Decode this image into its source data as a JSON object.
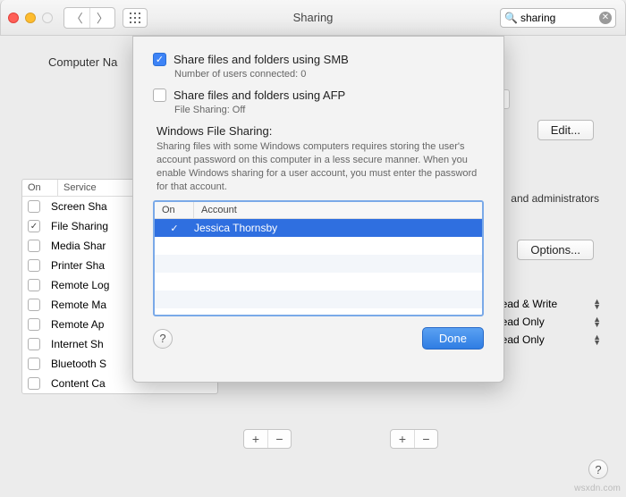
{
  "titlebar": {
    "title": "Sharing",
    "search_value": "sharing"
  },
  "main": {
    "computer_name_label": "Computer Na",
    "edit_label": "Edit...",
    "options_label": "Options...",
    "admins_text": "and administrators"
  },
  "services": {
    "head_on": "On",
    "head_service": "Service",
    "rows": [
      {
        "label": "Screen Sha",
        "checked": false
      },
      {
        "label": "File Sharing",
        "checked": true
      },
      {
        "label": "Media Shar",
        "checked": false
      },
      {
        "label": "Printer Sha",
        "checked": false
      },
      {
        "label": "Remote Log",
        "checked": false
      },
      {
        "label": "Remote Ma",
        "checked": false
      },
      {
        "label": "Remote Ap",
        "checked": false
      },
      {
        "label": "Internet Sh",
        "checked": false
      },
      {
        "label": "Bluetooth S",
        "checked": false
      },
      {
        "label": "Content Ca",
        "checked": false
      }
    ]
  },
  "permissions": {
    "rows": [
      "Read & Write",
      "Read Only",
      "Read Only"
    ]
  },
  "sheet": {
    "smb_label": "Share files and folders using SMB",
    "smb_sub": "Number of users connected: 0",
    "afp_label": "Share files and folders using AFP",
    "afp_sub": "File Sharing: Off",
    "wfs_title": "Windows File Sharing:",
    "wfs_desc": "Sharing files with some Windows computers requires storing the user's account password on this computer in a less secure manner. When you enable Windows sharing for a user account, you must enter the password for that account.",
    "acct_head_on": "On",
    "acct_head_account": "Account",
    "accounts": [
      {
        "name": "Jessica Thornsby",
        "checked": true,
        "selected": true
      }
    ],
    "done_label": "Done"
  },
  "watermark": "wsxdn.com"
}
